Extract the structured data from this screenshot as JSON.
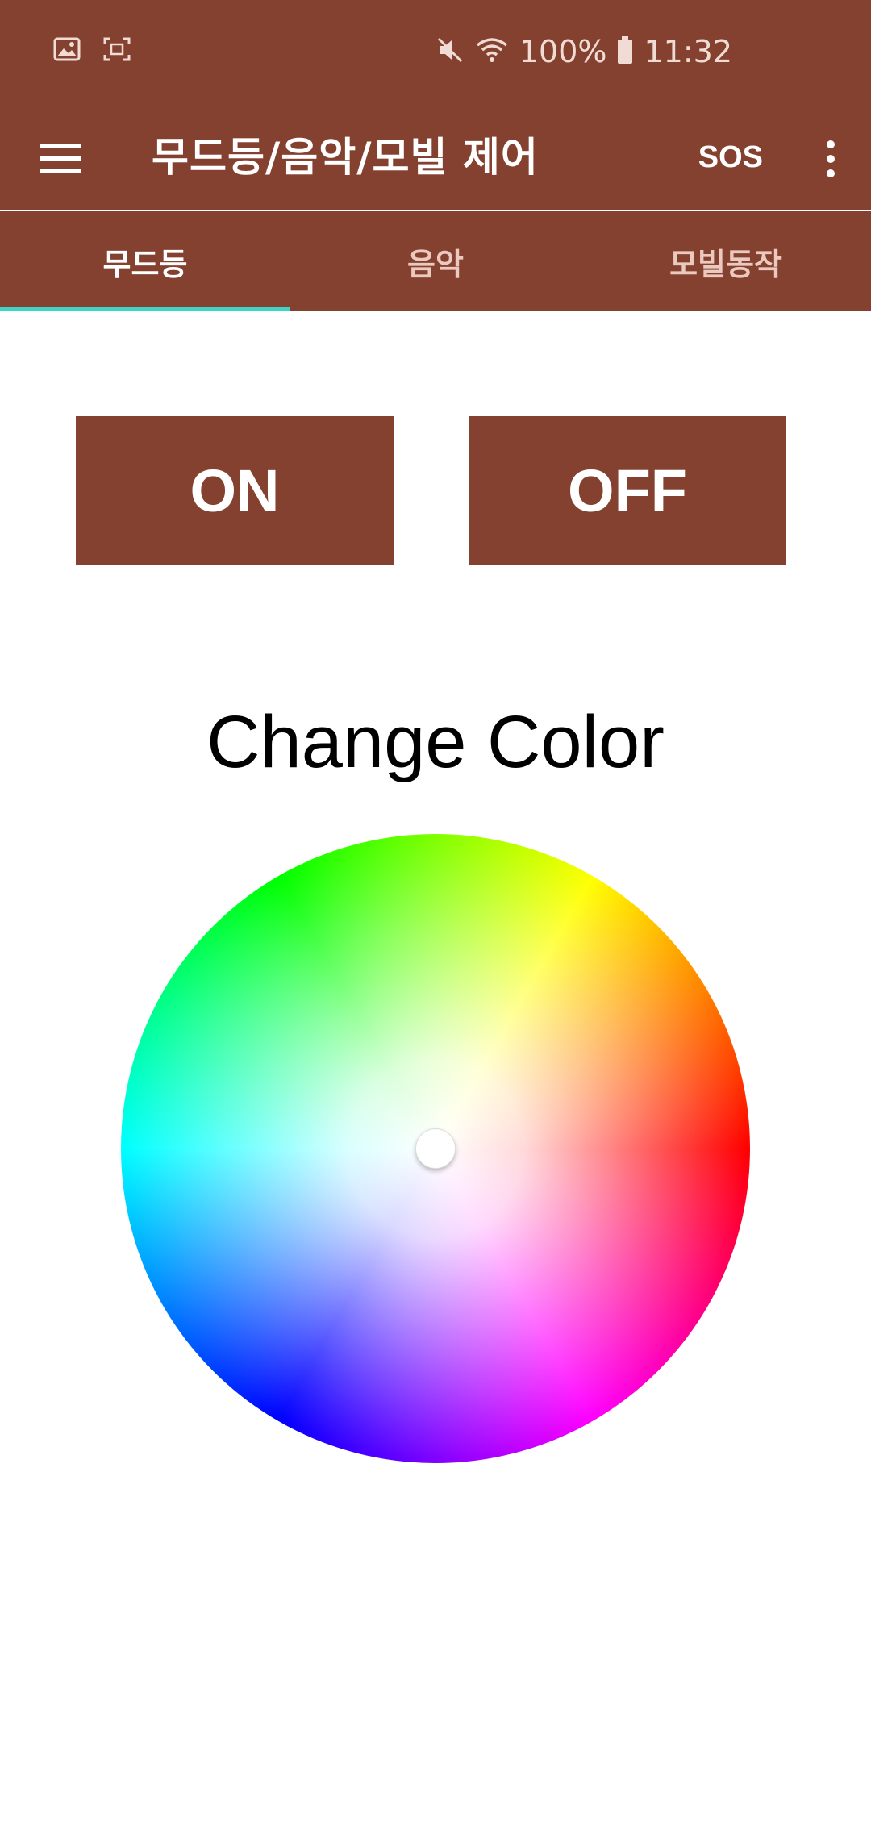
{
  "status_bar": {
    "battery": "100%",
    "time": "11:32",
    "left_icons": [
      "image-icon",
      "screenshot-icon"
    ],
    "right_icons": [
      "mute-icon",
      "wifi-icon",
      "battery-icon"
    ]
  },
  "app_bar": {
    "title": "무드등/음악/모빌 제어",
    "sos_label": "SOS"
  },
  "tabs": [
    {
      "label": "무드등",
      "active": true
    },
    {
      "label": "음악",
      "active": false
    },
    {
      "label": "모빌동작",
      "active": false
    }
  ],
  "controls": {
    "on_label": "ON",
    "off_label": "OFF"
  },
  "color_section": {
    "title": "Change Color"
  },
  "colors": {
    "primary": "#84412f",
    "tab_indicator": "#3fd4c8"
  }
}
